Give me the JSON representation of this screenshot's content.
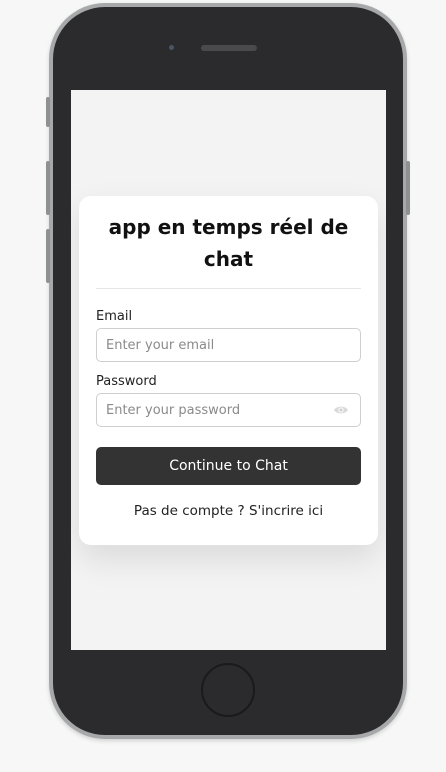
{
  "login": {
    "title": "app en temps réel de chat",
    "email_label": "Email",
    "email_placeholder": "Enter your email",
    "password_label": "Password",
    "password_placeholder": "Enter your password",
    "submit_label": "Continue to Chat",
    "signup_prompt": "Pas de compte ?",
    "signup_link": "S'incrire ici"
  },
  "icons": {
    "password_toggle": "eye-icon"
  },
  "colors": {
    "button_bg": "#333333",
    "screen_bg": "#f3f3f3",
    "card_bg": "#ffffff",
    "phone_frame": "#2b2b2d"
  }
}
